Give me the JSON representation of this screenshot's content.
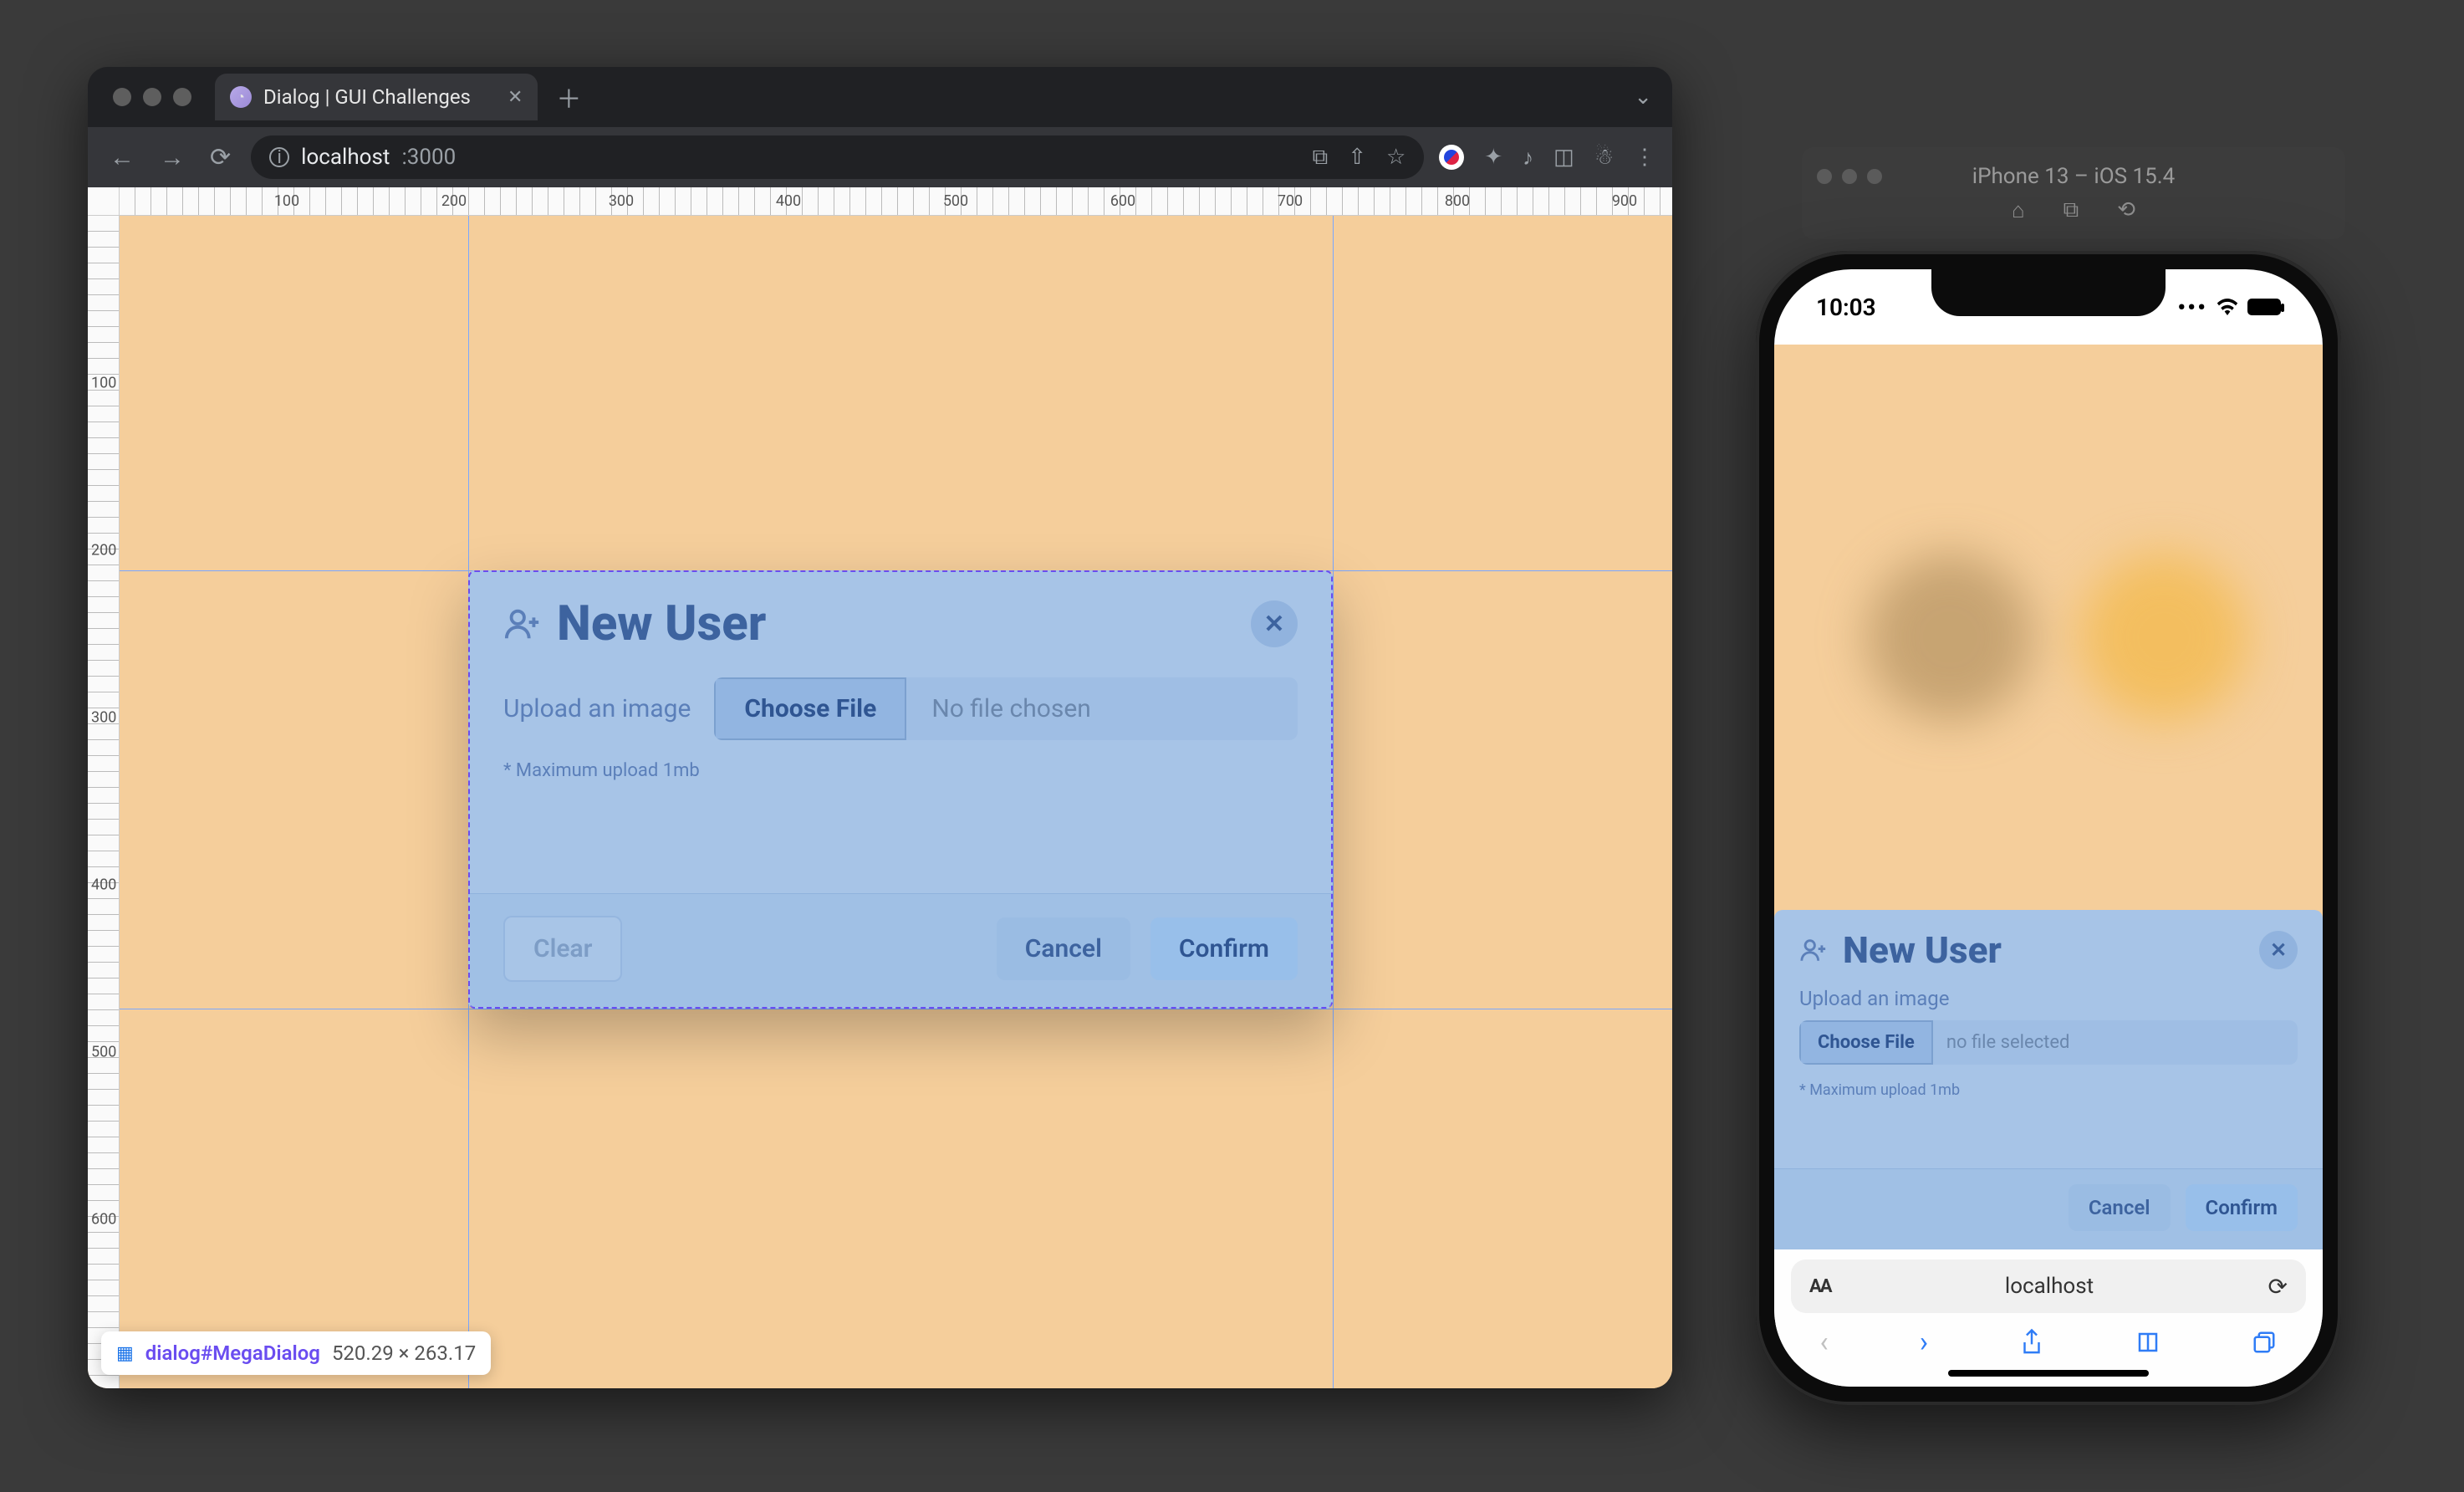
{
  "browser": {
    "tab_title": "Dialog | GUI Challenges",
    "url_host": "localhost",
    "url_port": ":3000"
  },
  "ruler": {
    "h": [
      "100",
      "200",
      "300",
      "400",
      "500",
      "600",
      "700",
      "800",
      "900"
    ],
    "v": [
      "100",
      "200",
      "300",
      "400",
      "500",
      "600"
    ]
  },
  "dialog": {
    "title": "New User",
    "upload_label": "Upload an image",
    "choose_file": "Choose File",
    "no_file": "No file chosen",
    "no_file_mobile": "no file selected",
    "hint": "* Maximum upload 1mb",
    "clear": "Clear",
    "cancel": "Cancel",
    "confirm": "Confirm"
  },
  "inspect": {
    "selector": "dialog#MegaDialog",
    "dimensions": "520.29 × 263.17"
  },
  "simulator": {
    "title": "iPhone 13 – iOS 15.4"
  },
  "phone": {
    "time": "10:03",
    "url": "localhost"
  }
}
